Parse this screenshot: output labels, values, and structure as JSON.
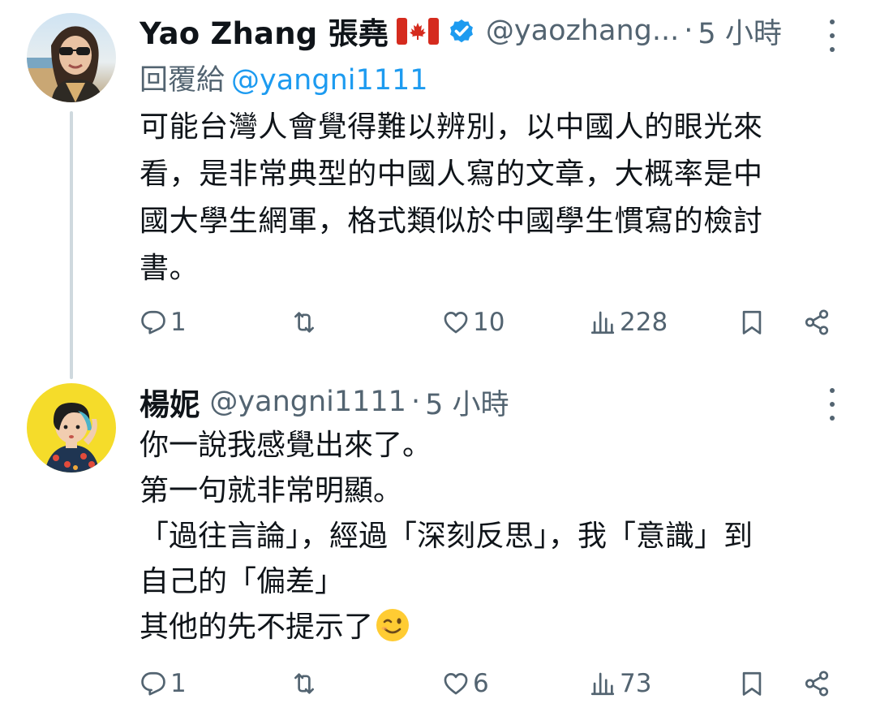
{
  "tweets": [
    {
      "author": {
        "display_name": "Yao Zhang 張堯",
        "flag": "canada-flag-emoji",
        "verified": true,
        "handle": "@yaozhang...",
        "time_sep": "·",
        "time": "5 小時"
      },
      "reply_to": {
        "label": "回覆給",
        "mention": "@yangni1111"
      },
      "text_lines": [
        "可能台灣人會覺得難以辨別，以中國人的眼光來",
        "看，是非常典型的中國人寫的文章，大概率是中",
        "國大學生網軍，格式類似於中國學生慣寫的檢討",
        "書。"
      ],
      "actions": {
        "replies": "1",
        "retweets": "",
        "likes": "10",
        "views": "228"
      }
    },
    {
      "author": {
        "display_name": "楊妮",
        "handle": "@yangni1111",
        "time_sep": "·",
        "time": "5 小時"
      },
      "text_lines": [
        "你一說我感覺出來了。",
        "第一句就非常明顯。",
        "「過往言論」，經過「深刻反思」，我「意識」到",
        "自己的「偏差」",
        "其他的先不提示了"
      ],
      "emoji": "winking-face-emoji",
      "actions": {
        "replies": "1",
        "retweets": "",
        "likes": "6",
        "views": "73"
      }
    }
  ],
  "colors": {
    "text_primary": "#0f1419",
    "text_secondary": "#536471",
    "link": "#1d9bf0",
    "verified": "#1d9bf0",
    "thread_line": "#cfd9de"
  },
  "icons": [
    "reply-icon",
    "retweet-icon",
    "like-icon",
    "views-icon",
    "bookmark-icon",
    "share-icon",
    "more-icon",
    "verified-badge-icon"
  ]
}
